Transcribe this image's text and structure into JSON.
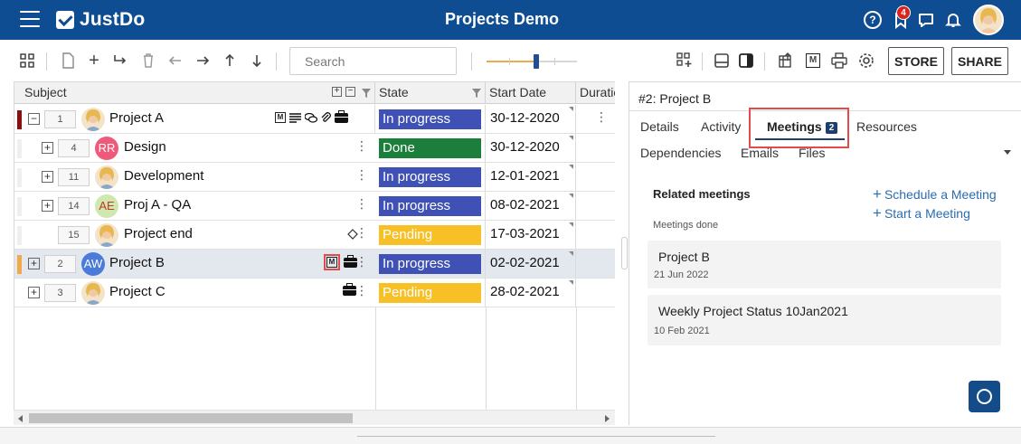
{
  "app": {
    "brand": "JustDo",
    "title": "Projects Demo",
    "notification_count": "4"
  },
  "toolbar": {
    "search_placeholder": "Search",
    "store_label": "STORE",
    "share_label": "SHARE",
    "zoom_level": 0.55
  },
  "grid": {
    "headers": {
      "subject": "Subject",
      "state": "State",
      "start_date": "Start Date",
      "duration": "Duration"
    },
    "rows": [
      {
        "seq": "1",
        "subject": "Project A",
        "avatar": "photo",
        "state": "In progress",
        "start_date": "30-12-2020",
        "priority_color": "#8b0f0f",
        "expander": "−"
      },
      {
        "seq": "4",
        "subject": "Design",
        "avatar": "RR",
        "state": "Done",
        "start_date": "30-12-2020",
        "expander": "+"
      },
      {
        "seq": "11",
        "subject": "Development",
        "avatar": "photo",
        "state": "In progress",
        "start_date": "12-01-2021",
        "expander": "+"
      },
      {
        "seq": "14",
        "subject": "Proj A - QA",
        "avatar": "AE",
        "state": "In progress",
        "start_date": "08-02-2021",
        "expander": "+"
      },
      {
        "seq": "15",
        "subject": "Project end",
        "avatar": "photo",
        "state": "Pending",
        "start_date": "17-03-2021"
      },
      {
        "seq": "2",
        "subject": "Project B",
        "avatar": "AW",
        "state": "In progress",
        "start_date": "02-02-2021",
        "priority_color": "#f0a94b",
        "expander": "+"
      },
      {
        "seq": "3",
        "subject": "Project C",
        "avatar": "photo",
        "state": "Pending",
        "start_date": "28-02-2021",
        "expander": "+"
      }
    ],
    "state_colors": {
      "In progress": "#3f51b5",
      "Done": "#1b7f3b",
      "Pending": "#f6c026"
    }
  },
  "panel": {
    "title": "#2: Project B",
    "tabs": {
      "details": "Details",
      "activity": "Activity",
      "meetings": "Meetings",
      "meetings_count": "2",
      "resources": "Resources",
      "dependencies": "Dependencies",
      "emails": "Emails",
      "files": "Files"
    },
    "related_meetings": "Related meetings",
    "meetings_done": "Meetings done",
    "schedule_meeting": "Schedule a Meeting",
    "start_meeting": "Start a Meeting",
    "meetings": [
      {
        "title": "Project B",
        "date": "21 Jun 2022"
      },
      {
        "title": "Weekly Project Status 10Jan2021",
        "date": "10 Feb 2021"
      }
    ]
  }
}
